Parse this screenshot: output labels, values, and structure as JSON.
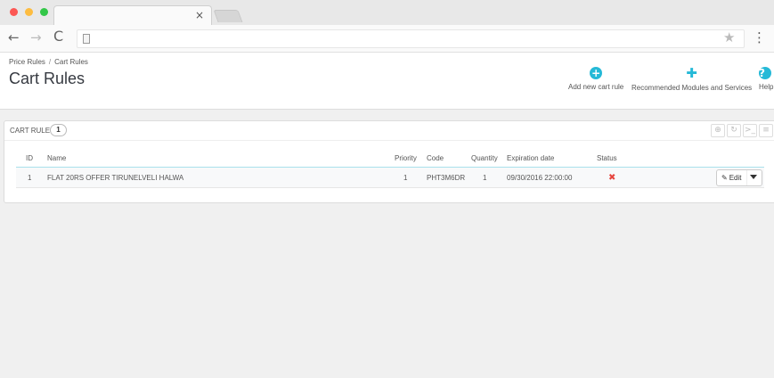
{
  "browser": {
    "tab_close_glyph": "×",
    "back_glyph": "←",
    "forward_glyph": "→",
    "reload_glyph": "C",
    "star_glyph": "★",
    "menu_glyph": "⋮"
  },
  "breadcrumb": {
    "items": [
      "Price Rules",
      "Cart Rules"
    ],
    "separator": "/"
  },
  "page_title": "Cart Rules",
  "toolbar": {
    "add": {
      "label": "Add new cart rule",
      "icon": "plus-circle-icon",
      "glyph": "+"
    },
    "recommended": {
      "label": "Recommended Modules and Services",
      "icon": "puzzle-icon",
      "glyph": "✚"
    },
    "help": {
      "label": "Help",
      "icon": "question-circle-icon",
      "glyph": "?"
    }
  },
  "panel": {
    "title": "Cart rules",
    "count": "1",
    "actions": [
      {
        "icon": "add-icon",
        "glyph": "⊕"
      },
      {
        "icon": "refresh-icon",
        "glyph": "↻"
      },
      {
        "icon": "sql-icon",
        "glyph": ">_"
      },
      {
        "icon": "export-icon",
        "glyph": "≡"
      }
    ]
  },
  "table": {
    "columns": {
      "id": "ID",
      "name": "Name",
      "priority": "Priority",
      "code": "Code",
      "quantity": "Quantity",
      "expiration": "Expiration date",
      "status": "Status"
    },
    "rows": [
      {
        "id": "1",
        "name": "FLAT 20RS OFFER TIRUNELVELI HALWA",
        "priority": "1",
        "code": "PHT3M6DR",
        "quantity": "1",
        "expiration": "09/30/2016 22:00:00",
        "status_glyph": "✖",
        "status_icon": "disabled-x-icon"
      }
    ]
  },
  "row_actions": {
    "edit_label": "Edit",
    "pencil_glyph": "✎"
  },
  "colors": {
    "accent": "#25b9d7",
    "status_disabled": "#e6463f"
  }
}
